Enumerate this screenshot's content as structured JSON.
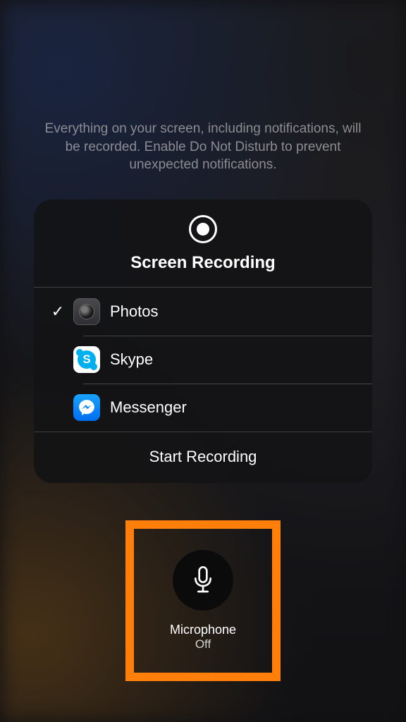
{
  "instruction": "Everything on your screen, including notifications, will be recorded. Enable Do Not Disturb to prevent unexpected notifications.",
  "panel": {
    "title": "Screen Recording",
    "apps": [
      {
        "label": "Photos",
        "selected": true
      },
      {
        "label": "Skype",
        "selected": false
      },
      {
        "label": "Messenger",
        "selected": false
      }
    ],
    "start_label": "Start Recording"
  },
  "mic": {
    "label": "Microphone",
    "state": "Off"
  },
  "highlight_color": "#ff7f0a"
}
